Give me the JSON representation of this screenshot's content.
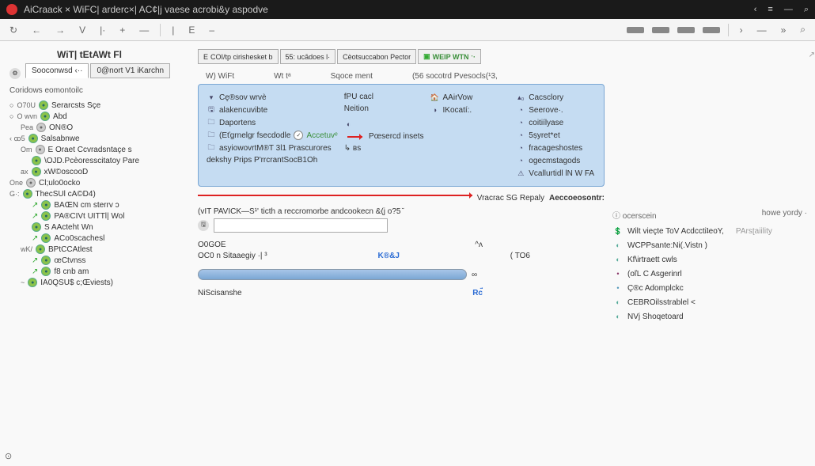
{
  "topbar": {
    "title": "AiCraack  ×  WiFC| arderc×|  AC¢|j vaese acrobi&y aspodve",
    "icons": {
      "back": "‹",
      "menu": "≡",
      "close": "—",
      "search": "⌕"
    }
  },
  "toolbar": {
    "items": [
      "↻",
      "←",
      "→",
      "V",
      "|·",
      "+",
      "—",
      "|",
      "E",
      "–"
    ],
    "right": [
      "›",
      "—",
      "»",
      "⌕"
    ]
  },
  "page": {
    "heading": "WiT| tEtAWt Fl",
    "tabs": {
      "main": "Sooconwsd ‹··",
      "second": "0@nort V1 iKarchn"
    },
    "long_tabs": [
      "COI/tp cirishesket b",
      "55: ucādoes  l·",
      "Cèotsuccabon Pector",
      "WEIP WTN ˑ·"
    ],
    "long_tabs_prefix_icon": "E"
  },
  "left": {
    "subhead": "Coridows eomontoilc",
    "tree": [
      {
        "prefix": "O70U",
        "icon": "green",
        "label": "Serarcsts Sçe",
        "indent": 0,
        "bullet": true
      },
      {
        "prefix": "O wvn",
        "icon": "green",
        "label": "Abd",
        "indent": 0,
        "bullet": true
      },
      {
        "prefix": "Pea",
        "icon": "grey",
        "label": "ON®O",
        "indent": 1
      },
      {
        "prefix": "‹  ꝏ5",
        "icon": "green",
        "label": "Salsabnwe",
        "indent": 0
      },
      {
        "prefix": "Om",
        "icon": "grey",
        "label": "E Oraet Ccvradsntaçe s",
        "indent": 1
      },
      {
        "prefix": "",
        "icon": "green",
        "label": "\\OJD.Pcèoresscitatoy Pare",
        "indent": 2
      },
      {
        "prefix": "ax",
        "icon": "green",
        "label": "xW©oscooD",
        "indent": 1
      },
      {
        "prefix": "One",
        "icon": "grey",
        "label": "Cl;ulo0ocko",
        "indent": 0
      },
      {
        "prefix": "G·:",
        "icon": "green",
        "label": "ThecSUl сA©D4)",
        "indent": 0
      },
      {
        "prefix": "",
        "icon": "green",
        "label": "BAŒN cm sterrv ɔ",
        "indent": 2,
        "arrow": true
      },
      {
        "prefix": "",
        "icon": "green",
        "label": "PA®CIVt UITTl| Wol",
        "indent": 2,
        "arrow": true
      },
      {
        "prefix": "",
        "icon": "green",
        "label": "S  AActeht Wn",
        "indent": 2
      },
      {
        "prefix": "",
        "icon": "green",
        "label": "ACo0scachesl",
        "indent": 2,
        "arrow": true
      },
      {
        "prefix": "wK/",
        "icon": "green",
        "label": "BPtCCAtlest",
        "indent": 1
      },
      {
        "prefix": "",
        "icon": "green",
        "label": "œCtvnss",
        "indent": 2,
        "arrow": true
      },
      {
        "prefix": "",
        "icon": "green",
        "label": "f8 cnb am",
        "indent": 2,
        "arrow": true
      },
      {
        "prefix": "~",
        "icon": "green",
        "label": "IA0QSU$ c;Œviests)",
        "indent": 1
      }
    ]
  },
  "mid": {
    "col_headers": [
      "W) WiFt",
      "Wt tᵃ",
      "Sqoce ment",
      "(56 socotrd Pvesocls(¹3,"
    ],
    "blue": {
      "c1": [
        {
          "icon": "▾",
          "text": "Cę®sov wrvè",
          "extra": "↖"
        },
        {
          "icon": "🖫",
          "text": "alakencuvibte"
        },
        {
          "icon": "🗀",
          "text": "Daportens"
        },
        {
          "icon": "🗀",
          "text": "(Eťgrnelgr fsecdodle",
          "badge": "Accetuvᵉ"
        },
        {
          "icon": "🗀",
          "text": "asyiowovrtM®T 3l1 Prascurores"
        },
        {
          "icon": "",
          "text": "dekshy Prips P'rrcrantSocB1Oh"
        }
      ],
      "c2": [
        {
          "icon": "",
          "text": "fPU cacl"
        },
        {
          "icon": "",
          "text": "Neition"
        },
        {
          "icon": "",
          "text": ""
        },
        {
          "icon": "◐",
          "text": ""
        },
        {
          "icon": "",
          "text": "Pœsercd insets",
          "red": true
        },
        {
          "icon": "",
          "text": "↳ ʙs"
        }
      ],
      "c3": [
        {
          "icon": "🏠",
          "text": "AAirVow"
        },
        {
          "icon": "◑",
          "text": "IKocatí:."
        },
        {
          "icon": "",
          "text": ""
        },
        {
          "icon": "",
          "text": ""
        },
        {
          "icon": "",
          "text": ""
        }
      ],
      "c4": [
        {
          "icon": "▴₀",
          "text": "Cacsclory"
        },
        {
          "icon": "◔",
          "text": "Seerove·."
        },
        {
          "icon": "◔",
          "text": "coitiílyase"
        },
        {
          "icon": "◔",
          "text": "5ṣyret*et"
        },
        {
          "icon": "◔",
          "text": "fracageshostes"
        },
        {
          "icon": "◔",
          "text": "ogecmstagods"
        },
        {
          "icon": "⚠",
          "text": "Vcallurtidl lN W FA"
        }
      ]
    },
    "trail": {
      "left": "Vracrac SG Repaly",
      "right": "Aeccoeosontr:"
    },
    "lower": {
      "cmd": "(vIT PAVICK—S¹' ticth a reccromorbe andcookecn &(j  o?5 ̆",
      "input_icon": "🖫",
      "row1_l": "O0GOE",
      "row1_r": "^ʌ",
      "row2_l": "OC0 n Sitaaegiy   ·|  ³",
      "row2_mid": "K®&J",
      "row2_r": "( TO6",
      "prog_end": "∞",
      "last_l": "NiScisanshe",
      "last_r": "Rc̈́"
    }
  },
  "right": {
    "head_l": "ⓘ ocerscein",
    "head_r": "howe yordy ·",
    "list1": [
      {
        "icon": "💲",
        "text": "Wilt  vieçte ToV  AcdcctiʇeoY,",
        "extra": "  PArsʈaiility",
        "color": "#5a9"
      },
      {
        "icon": "◐",
        "text": "WCPPsante:Ni(.Vistn )",
        "color": "#5a9"
      },
      {
        "icon": "◐",
        "text": "Kf\\irtraett cwls",
        "color": "#5a9"
      },
      {
        "icon": "",
        "text": "(oľL C Asgerinrl",
        "color": "#836"
      },
      {
        "icon": "",
        "text": "Ç®c  Adomplckc",
        "color": "#59b"
      },
      {
        "icon": "◐",
        "text": "CEBROilsstrablel ˂",
        "color": "#5a9"
      },
      {
        "icon": "◐",
        "text": "NVj Shoqetoard",
        "color": "#5a9"
      }
    ]
  },
  "status": "⊙"
}
